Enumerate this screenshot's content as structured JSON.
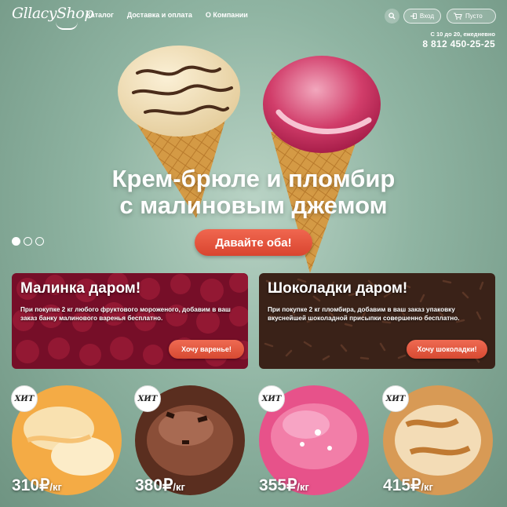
{
  "header": {
    "logo": "GllacyShop",
    "nav": [
      "Каталог",
      "Доставка и оплата",
      "О Компании"
    ],
    "login_label": "Вход",
    "cart_label": "Пусто",
    "hours": "С 10 до 20, ежедневно",
    "phone": "8 812 450-25-25"
  },
  "hero": {
    "title_line1": "Крем-брюле и пломбир",
    "title_line2": "с малиновым джемом",
    "cta_label": "Давайте оба!",
    "slides": 3,
    "active_slide": 1
  },
  "promos": [
    {
      "title": "Малинка даром!",
      "text": "При покупке 2 кг любого фруктового мороженого, добавим в ваш заказ банку малинового варенья бесплатно.",
      "button": "Хочу варенье!"
    },
    {
      "title": "Шоколадки даром!",
      "text": "При покупке 2 кг пломбира, добавим в ваш заказ упаковку вкуснейшей шоколадной присыпки совершенно бесплатно.",
      "button": "Хочу шоколадки!"
    }
  ],
  "products": [
    {
      "badge": "ХИТ",
      "price": "310",
      "currency": "₽",
      "unit": "/кг"
    },
    {
      "badge": "ХИТ",
      "price": "380",
      "currency": "₽",
      "unit": "/кг"
    },
    {
      "badge": "ХИТ",
      "price": "355",
      "currency": "₽",
      "unit": "/кг"
    },
    {
      "badge": "ХИТ",
      "price": "415",
      "currency": "₽",
      "unit": "/кг"
    }
  ],
  "colors": {
    "background": "#8fb4a2",
    "accent_button": "#e4553d"
  }
}
